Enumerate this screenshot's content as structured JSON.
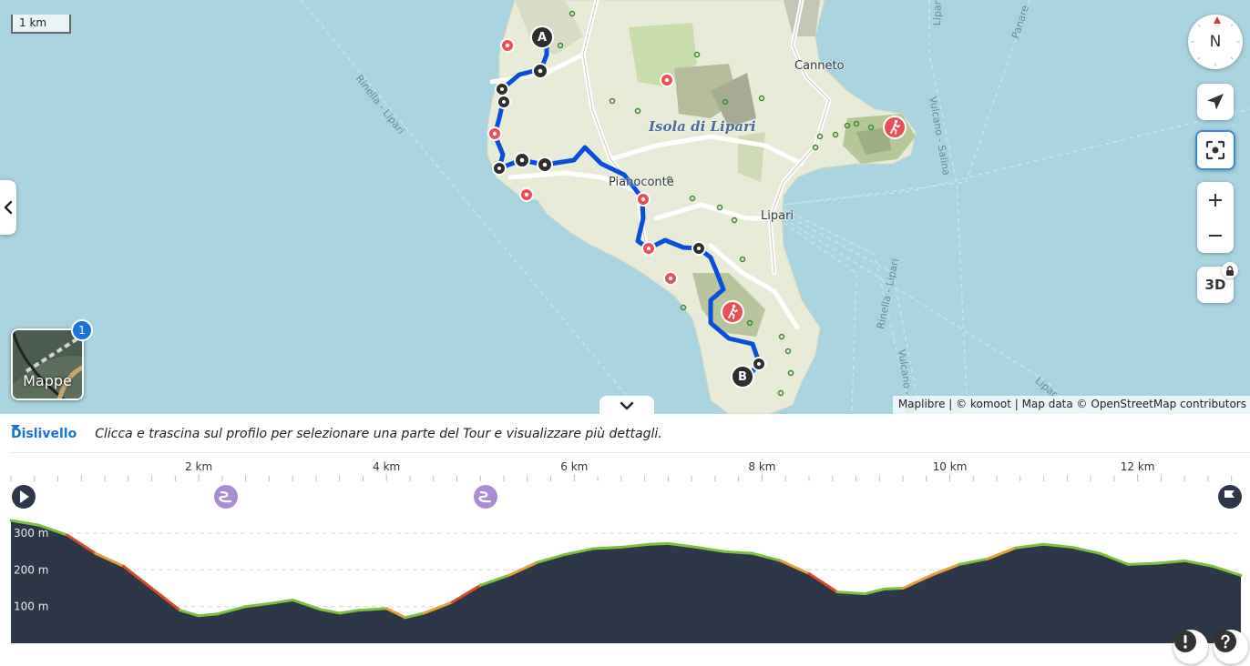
{
  "map": {
    "scale_label": "1 km",
    "labels": {
      "canneto": "Canneto",
      "island": "Isola di Lipari",
      "pianoconte": "Pianoconte",
      "lipari": "Lipari",
      "ferry_rinella_lipari_1": "Rinella - Lipari",
      "ferry_rinella_lipari_2": "Rinella - Lipari",
      "ferry_vulcano_salina": "Vulcano - Salina",
      "ferry_vulcano_lipari": "Vulcano - Lipari",
      "ferry_lipari": "Lipar",
      "ferry_panarea": "Panare",
      "ferry_lipari_top": "Lipari"
    },
    "waypoint_start": "A",
    "waypoint_end": "B",
    "compass_label": "N",
    "btn_3d": "3D",
    "layers_label": "Mappe",
    "layers_badge": "1",
    "attribution": "Maplibre | © komoot | Map data © OpenStreetMap contributors",
    "icons": [
      "chevron-left-icon",
      "navigation-arrow-icon",
      "focus-icon",
      "plus-icon",
      "minus-icon",
      "lock-icon",
      "chevron-down-icon",
      "hiker-icon"
    ]
  },
  "profile": {
    "metric_label": "Dislivello",
    "hint": "Clicca e trascina sul profilo per selezionare una parte del Tour e visualizzare più dettagli.",
    "x_ticks": [
      "2 km",
      "4 km",
      "6 km",
      "8 km",
      "10 km",
      "12 km"
    ],
    "y_ticks": [
      "300 m",
      "200 m",
      "100 m"
    ]
  },
  "chart_data": {
    "type": "area",
    "xlabel": "",
    "ylabel": "",
    "x_unit": "km",
    "y_unit": "m",
    "xlim": [
      0,
      13.1
    ],
    "ylim": [
      0,
      340
    ],
    "x": [
      0,
      0.3,
      0.6,
      0.9,
      1.2,
      1.5,
      1.8,
      2.0,
      2.2,
      2.5,
      2.8,
      3.0,
      3.3,
      3.5,
      3.7,
      4.0,
      4.2,
      4.4,
      4.7,
      5.0,
      5.3,
      5.6,
      5.9,
      6.2,
      6.5,
      6.8,
      7.0,
      7.3,
      7.6,
      7.9,
      8.2,
      8.5,
      8.8,
      9.1,
      9.3,
      9.5,
      9.8,
      10.1,
      10.4,
      10.7,
      11.0,
      11.3,
      11.6,
      11.9,
      12.2,
      12.5,
      12.8,
      13.1
    ],
    "values": [
      335,
      322,
      295,
      245,
      210,
      150,
      90,
      75,
      80,
      100,
      110,
      118,
      92,
      82,
      90,
      95,
      70,
      82,
      112,
      158,
      185,
      220,
      242,
      258,
      262,
      270,
      272,
      262,
      250,
      245,
      225,
      190,
      140,
      135,
      148,
      150,
      185,
      215,
      230,
      260,
      270,
      262,
      245,
      215,
      218,
      225,
      210,
      185
    ],
    "grid": true,
    "legend": "none",
    "colors": {
      "fill": "#2e3747",
      "line": "#7fbf3f",
      "steep": "#d84a2a",
      "moderate": "#e1a13a",
      "grid": "#d6d6d6"
    }
  },
  "colors": {
    "accent": "#1a73d9",
    "route": "#0a4fd9",
    "poi": "#e94f55",
    "sea": "#a9d3df",
    "land": "#e9ebd9"
  }
}
